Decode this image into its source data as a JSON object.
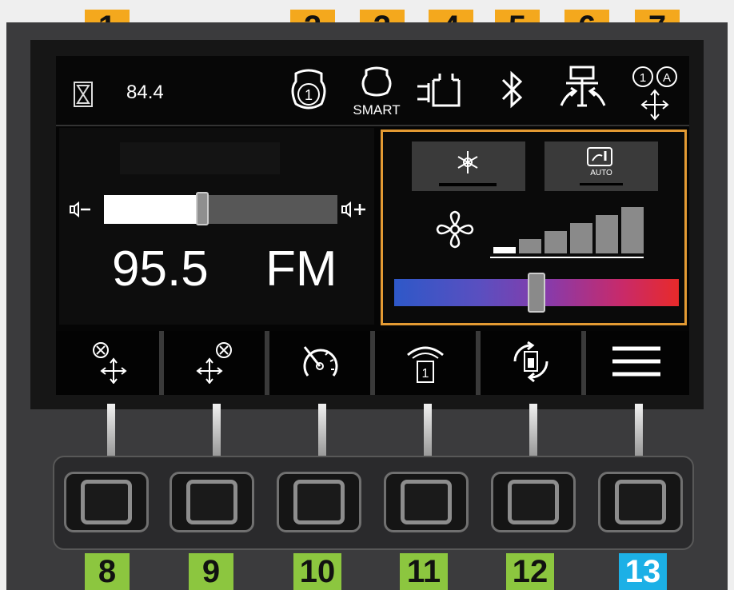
{
  "callouts": {
    "top": [
      "1",
      "2",
      "3",
      "4",
      "5",
      "6",
      "7"
    ],
    "bottom": [
      "8",
      "9",
      "10",
      "11",
      "12",
      "13"
    ]
  },
  "colors": {
    "callout_orange": "#f4a81d",
    "callout_green": "#8cc63f",
    "callout_blue": "#1cb0e6",
    "climate_border": "#e39a33"
  },
  "status": {
    "hours_value": "84.4",
    "smart_label": "SMART"
  },
  "radio": {
    "frequency": "95.5",
    "band": "FM",
    "volume_level": 0.42
  },
  "climate": {
    "auto_label": "AUTO",
    "fan_level": 1,
    "fan_levels_total": 6,
    "temperature_level": 0.5
  },
  "icons": {
    "status": [
      "hourglass-icon",
      "engine-mode-1-icon",
      "engine-smart-icon",
      "transmission-icon",
      "bluetooth-icon",
      "hydraulic-joystick-icon",
      "joystick-mode-1a-icon"
    ],
    "softkeys": [
      "joystick-x-left-icon",
      "joystick-x-right-icon",
      "speed-dial-icon",
      "gauge-gear-1-icon",
      "auto-rotate-icon",
      "menu-icon"
    ]
  }
}
